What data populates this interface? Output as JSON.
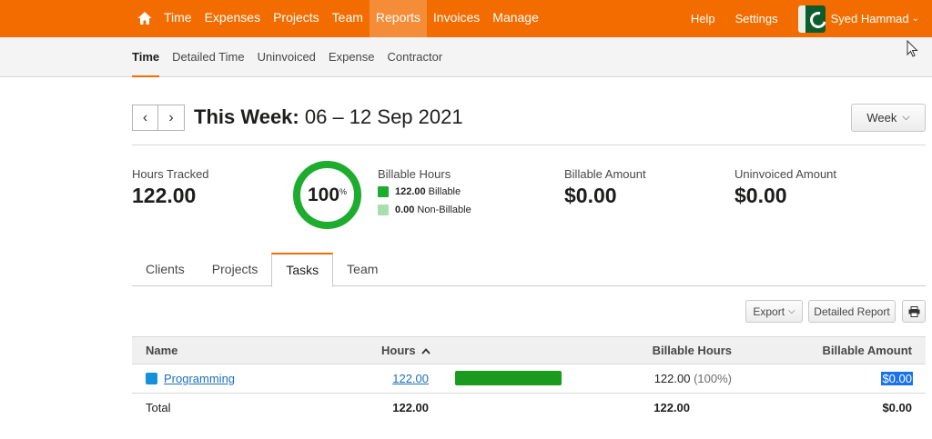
{
  "topnav": {
    "items": [
      "Time",
      "Expenses",
      "Projects",
      "Team",
      "Reports",
      "Invoices",
      "Manage"
    ],
    "active": "Reports",
    "help": "Help",
    "settings": "Settings",
    "user": "Syed Hammad",
    "brand_color": "#f36c00"
  },
  "subnav": {
    "items": [
      "Time",
      "Detailed Time",
      "Uninvoiced",
      "Expense",
      "Contractor"
    ],
    "active": "Time"
  },
  "header": {
    "period_label": "This Week:",
    "period_range": "06 – 12 Sep 2021",
    "range_button": "Week"
  },
  "stats": {
    "hours_tracked_label": "Hours Tracked",
    "hours_tracked_value": "122.00",
    "billable_percent": "100",
    "billable_percent_symbol": "%",
    "billable_hours_label": "Billable Hours",
    "billable_value": "122.00",
    "billable_text": "Billable",
    "non_billable_value": "0.00",
    "non_billable_text": "Non-Billable",
    "billable_amount_label": "Billable Amount",
    "billable_amount_value": "$0.00",
    "uninvoiced_amount_label": "Uninvoiced Amount",
    "uninvoiced_amount_value": "$0.00",
    "billable_color": "#1eac2f",
    "non_billable_color": "#a8dfae"
  },
  "tabs": {
    "items": [
      "Clients",
      "Projects",
      "Tasks",
      "Team"
    ],
    "active": "Tasks"
  },
  "toolbar": {
    "export": "Export",
    "detailed_report": "Detailed Report"
  },
  "table": {
    "headers": {
      "name": "Name",
      "hours": "Hours",
      "billable_hours": "Billable Hours",
      "billable_amount": "Billable Amount"
    },
    "rows": [
      {
        "name": "Programming",
        "hours": "122.00",
        "billable_hours": "122.00",
        "billable_percent": "(100%)",
        "billable_amount": "$0.00",
        "hours_fraction": 1.0
      }
    ],
    "total": {
      "label": "Total",
      "hours": "122.00",
      "billable_hours": "122.00",
      "billable_amount": "$0.00"
    }
  }
}
